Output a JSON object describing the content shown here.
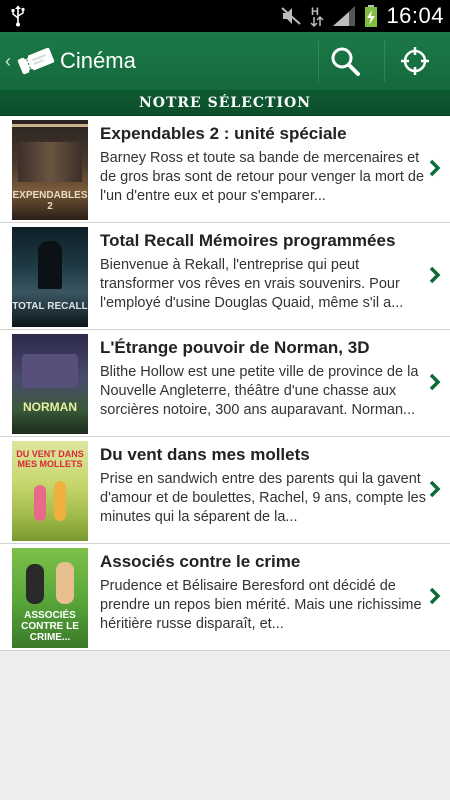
{
  "status_bar": {
    "time": "16:04"
  },
  "action_bar": {
    "title": "Cinéma"
  },
  "section_title": "NOTRE SÉLECTION",
  "movies": [
    {
      "title": "Expendables 2 : unité spéciale",
      "summary": "Barney Ross et toute sa bande de mercenaires et de gros bras sont de retour pour venger la mort de l'un d'entre eux et pour s'emparer...",
      "poster_text": "EXPENDABLES 2"
    },
    {
      "title": "Total Recall Mémoires programmées",
      "summary": "Bienvenue à Rekall, l'entreprise qui peut transformer vos rêves en vrais souvenirs. Pour l'employé d'usine Douglas Quaid, même s'il a...",
      "poster_text": "TOTAL RECALL"
    },
    {
      "title": "L'Étrange pouvoir de Norman, 3D",
      "summary": "Blithe Hollow est une petite ville de province de la Nouvelle Angleterre, théâtre d'une chasse aux sorcières notoire, 300 ans auparavant. Norman...",
      "poster_text": "NORMAN"
    },
    {
      "title": "Du vent dans mes mollets",
      "summary": "Prise en sandwich entre des parents qui la gavent d'amour et de boulettes, Rachel, 9 ans, compte les minutes qui la séparent de la...",
      "poster_text": "DU VENT DANS MES MOLLETS"
    },
    {
      "title": "Associés contre le crime",
      "summary": "Prudence et Bélisaire Beresford ont décidé de prendre un repos bien mérité. Mais une richissime héritière russe disparaît, et...",
      "poster_text": "ASSOCIÉS CONTRE LE CRIME..."
    }
  ],
  "colors": {
    "action_bar": "#17713f",
    "section_bar": "#0d5530",
    "chevron": "#0f6b35"
  }
}
